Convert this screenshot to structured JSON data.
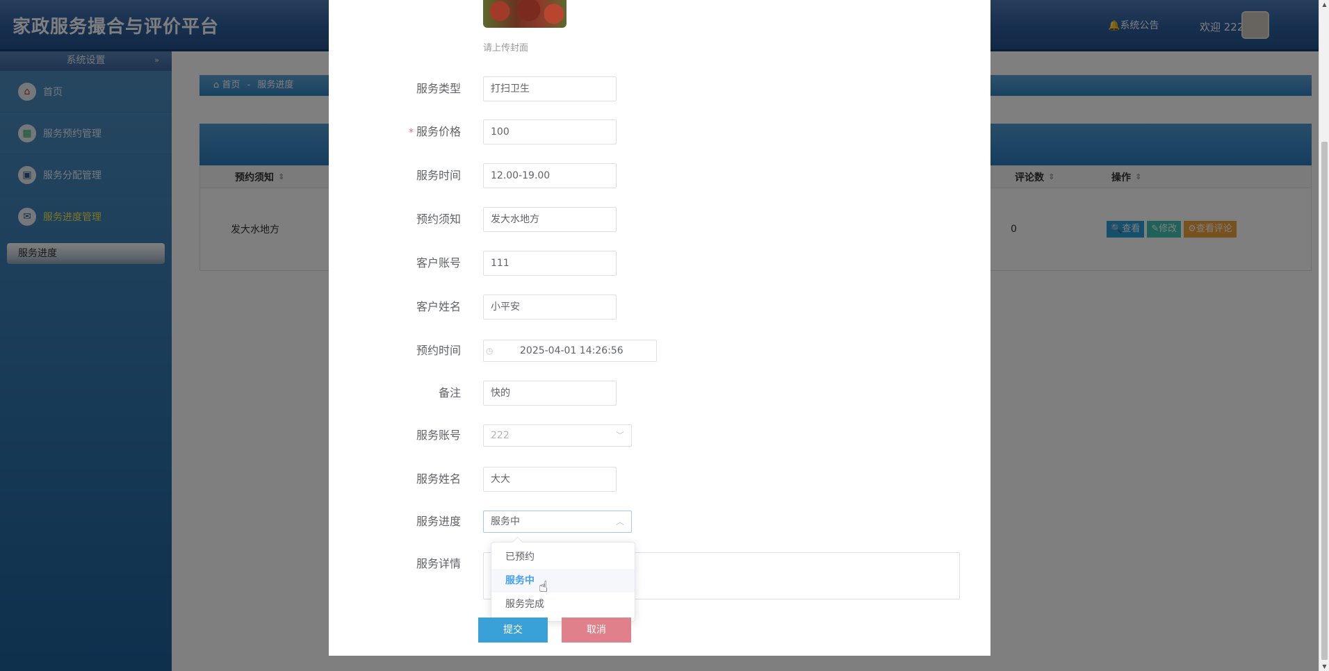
{
  "app": {
    "title": "家政服务撮合与评价平台",
    "notice": "系统公告",
    "welcome": "欢迎 222"
  },
  "sidebar": {
    "header": "系统设置",
    "items": [
      {
        "label": "首页",
        "icon": "home-icon"
      },
      {
        "label": "服务预约管理",
        "icon": "calendar-icon"
      },
      {
        "label": "服务分配管理",
        "icon": "assign-icon"
      },
      {
        "label": "服务进度管理",
        "icon": "mail-icon"
      }
    ],
    "sub_item": "服务进度"
  },
  "breadcrumb": {
    "home": "首页",
    "separator": "-",
    "current": "服务进度"
  },
  "table": {
    "headers": {
      "notice": "预约须知",
      "comments": "评论数",
      "actions": "操作"
    },
    "row": {
      "notice": "发大水地方",
      "comments": "0"
    },
    "actions": {
      "view": "查看",
      "edit": "修改",
      "review": "查看评论"
    }
  },
  "form": {
    "cover_hint": "请上传封面",
    "fields": {
      "service_type": {
        "label": "服务类型",
        "value": "打扫卫生"
      },
      "service_price": {
        "label": "服务价格",
        "value": "100",
        "required_mark": "*"
      },
      "service_time": {
        "label": "服务时间",
        "value": "12.00-19.00"
      },
      "booking_notice": {
        "label": "预约须知",
        "value": "发大水地方"
      },
      "customer_account": {
        "label": "客户账号",
        "value": "111"
      },
      "customer_name": {
        "label": "客户姓名",
        "value": "小平安"
      },
      "booking_time": {
        "label": "预约时间",
        "value": "2025-04-01 14:26:56"
      },
      "remark": {
        "label": "备注",
        "value": "快的"
      },
      "service_account": {
        "label": "服务账号",
        "value": "222"
      },
      "service_name": {
        "label": "服务姓名",
        "value": "大大"
      },
      "service_progress": {
        "label": "服务进度",
        "value": "服务中"
      },
      "service_detail": {
        "label": "服务详情",
        "value": ""
      }
    },
    "progress_options": [
      "已预约",
      "服务中",
      "服务完成"
    ],
    "progress_selected": "服务中",
    "buttons": {
      "submit": "提交",
      "cancel": "取消"
    }
  },
  "colors": {
    "primary": "#3aa0d8",
    "danger": "#e0808a",
    "selected": "#409eff",
    "active_menu": "#f6e84c"
  }
}
